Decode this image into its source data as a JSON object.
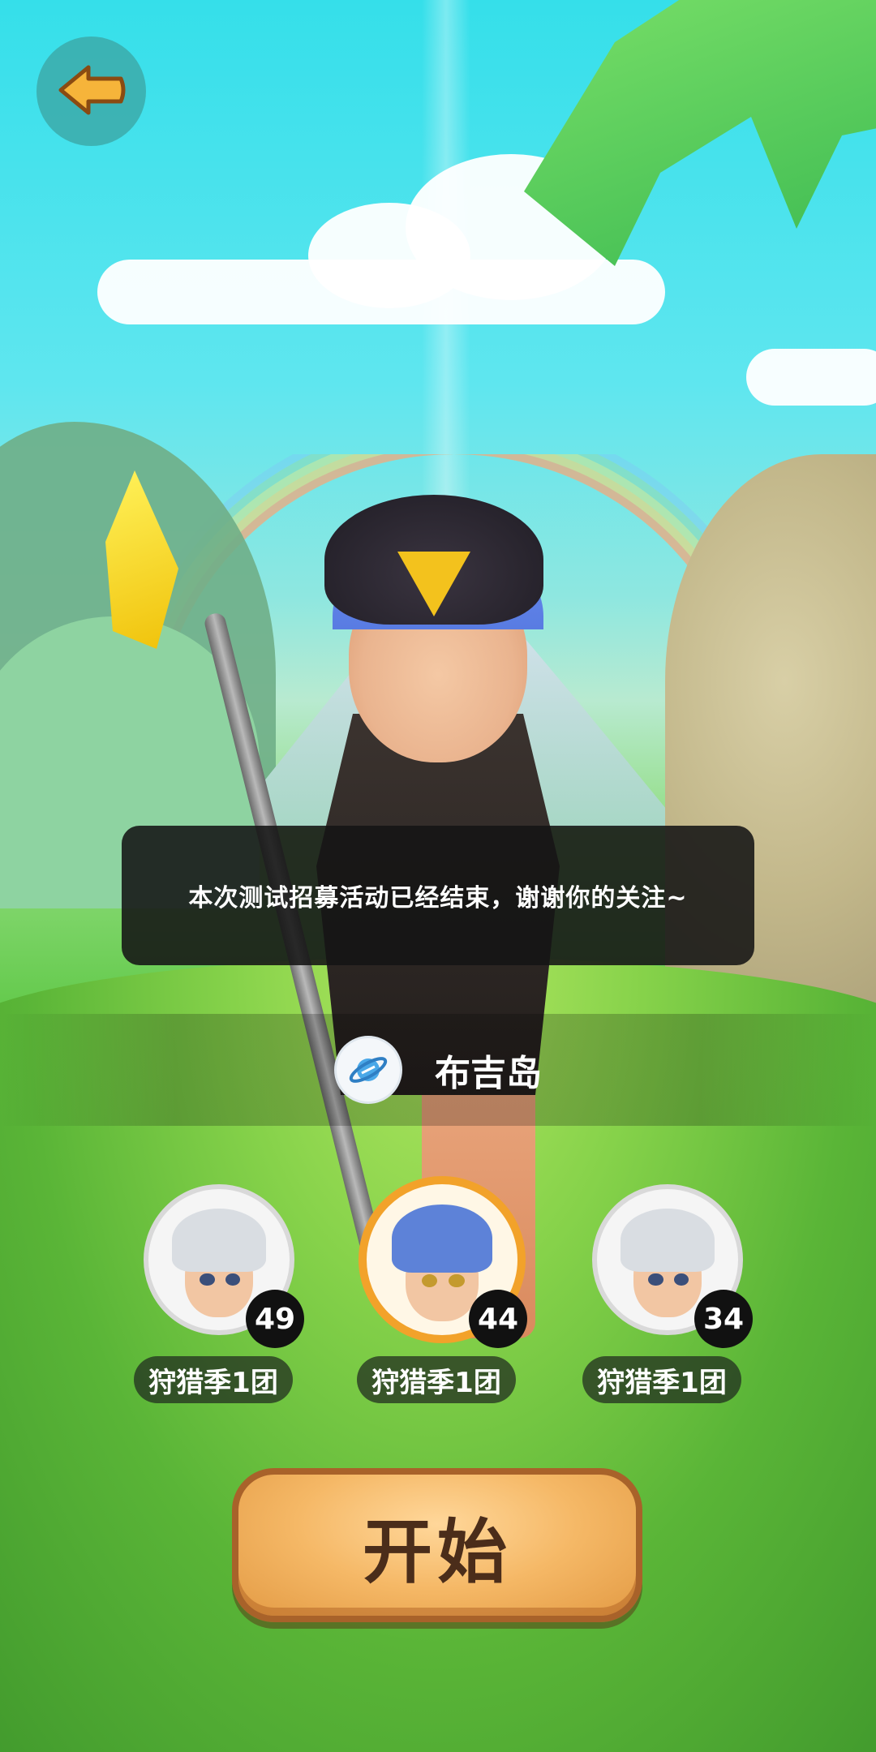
{
  "toast": {
    "message": "本次测试招募活动已经结束，谢谢你的关注~"
  },
  "server": {
    "name": "布吉岛",
    "icon": "server-planet-icon"
  },
  "characters": [
    {
      "level": "49",
      "team": "狩猎季1团",
      "hair_color": "#d9dde2",
      "selected": false
    },
    {
      "level": "44",
      "team": "狩猎季1团",
      "hair_color": "#5d82d8",
      "selected": true
    },
    {
      "level": "34",
      "team": "狩猎季1团",
      "hair_color": "#d9dde2",
      "selected": false
    }
  ],
  "start_button": {
    "label": "开始"
  },
  "back_button": {
    "icon": "back-arrow-icon"
  },
  "colors": {
    "selected_ring": "#f2a22a",
    "back_button_bg": "#3caaaa",
    "start_button": "#f5b866"
  }
}
